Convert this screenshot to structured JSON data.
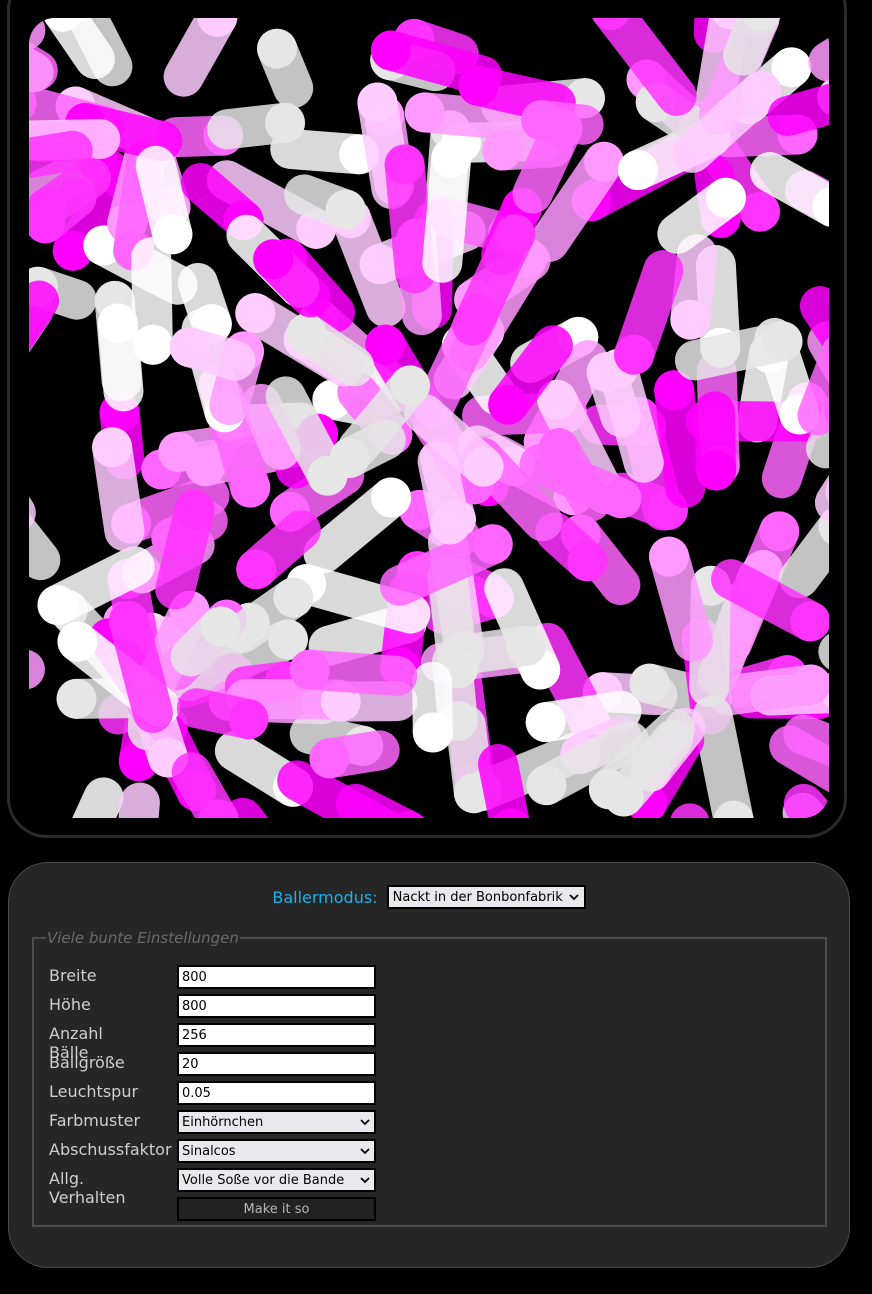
{
  "mode": {
    "label": "Ballermodus:",
    "selected": "Nackt in der Bonbonfabrik"
  },
  "settings": {
    "legend": "Viele bunte Einstellungen",
    "fields": [
      {
        "label": "Breite",
        "value": "800"
      },
      {
        "label": "Höhe",
        "value": "800"
      },
      {
        "label": "Anzahl Bälle",
        "value": "256"
      },
      {
        "label": "Ballgröße",
        "value": "20"
      },
      {
        "label": "Leuchtspur",
        "value": "0.05"
      }
    ],
    "selects": [
      {
        "label": "Farbmuster",
        "value": "Einhörnchen"
      },
      {
        "label": "Abschussfaktor",
        "value": "Sinalcos"
      },
      {
        "label": "Allg. Verhalten",
        "value": "Volle Soße vor die Bande"
      }
    ],
    "submit_label": "Make it so"
  },
  "colors": {
    "accent": "#1ab0e8",
    "ball_palette": [
      "#ff00ff",
      "#ff33ff",
      "#ff66ff",
      "#ff99ff",
      "#ffccff",
      "#ffffff",
      "#e6e6e6"
    ]
  }
}
